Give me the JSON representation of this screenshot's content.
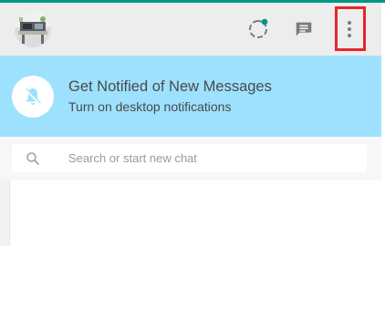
{
  "colors": {
    "accent": "#009688",
    "header_bg": "#ededed",
    "banner_bg": "#9de1fe",
    "highlight_border": "#e4272a",
    "icon_gray": "#7a7a7a"
  },
  "header": {
    "avatar": "profile-avatar",
    "icons": [
      "status-icon",
      "new-chat-icon",
      "menu-icon"
    ]
  },
  "notification_banner": {
    "icon": "bell-off-icon",
    "title": "Get Notified of New Messages",
    "link": "Turn on desktop notifications"
  },
  "search": {
    "icon": "search-icon",
    "placeholder": "Search or start new chat",
    "value": ""
  }
}
